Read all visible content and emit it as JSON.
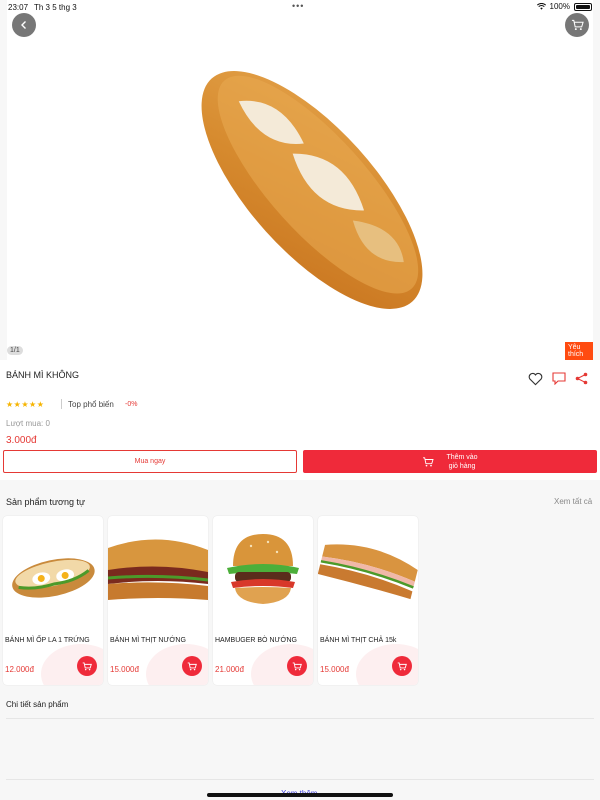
{
  "status_bar": {
    "time": "23:07",
    "date": "Th 3 5 thg 3",
    "battery": "100%"
  },
  "hero": {
    "image_counter": "1/1",
    "favorite_tag": "Yêu thích"
  },
  "product": {
    "name": "BÁNH MÌ KHÔNG",
    "stars": "★★★★★",
    "top_label": "Top phổ biến",
    "discount": "-0%",
    "sold": "Lượt mua: 0",
    "price": "3.000đ"
  },
  "buttons": {
    "buy_now": "Mua ngay",
    "add_to_cart_line1": "Thêm vào",
    "add_to_cart_line2": "giỏ hàng"
  },
  "similar": {
    "title": "Sản phẩm tương tự",
    "see_all": "Xem tất cả",
    "items": [
      {
        "name": "BÁNH MÌ ỐP LA 1 TRỨNG",
        "price": "12.000đ"
      },
      {
        "name": "BÁNH MÌ THỊT NƯỚNG",
        "price": "15.000đ"
      },
      {
        "name": "HAMBUGER BÒ NƯỚNG",
        "price": "21.000đ"
      },
      {
        "name": "BÁNH MÌ THỊT CHẢ 15k",
        "price": "15.000đ"
      }
    ]
  },
  "details": {
    "title": "Chi tiết sản phẩm",
    "see_more": "Xem thêm"
  },
  "icons": {
    "back": "chevron-left-icon",
    "cart": "cart-icon",
    "heart": "heart-icon",
    "comment": "comment-icon",
    "share": "share-icon",
    "wifi": "wifi-icon",
    "battery": "battery-icon"
  },
  "colors": {
    "accent": "#ef2a3a",
    "price": "#e53935",
    "favorite": "#ff4b10",
    "stars": "#f6b400"
  }
}
